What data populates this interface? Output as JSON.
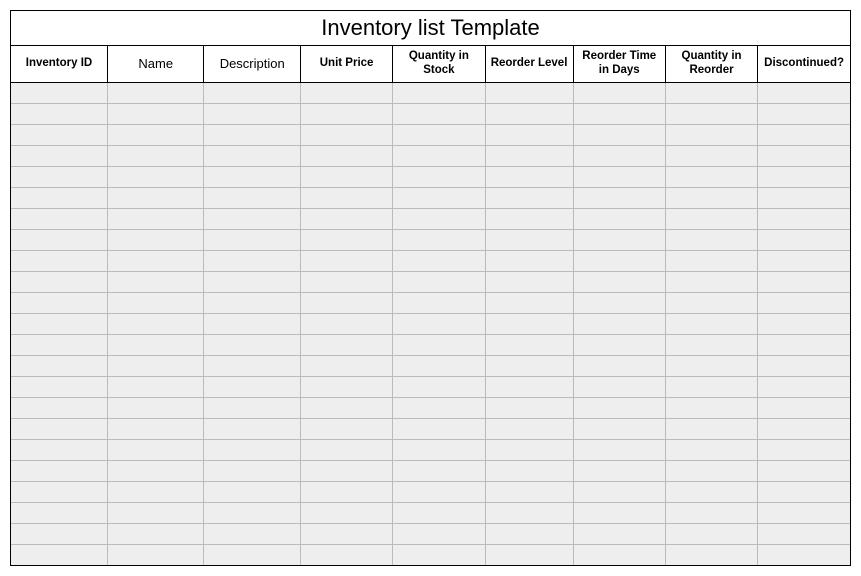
{
  "title": "Inventory list Template",
  "columns": [
    "Inventory ID",
    "Name",
    "Description",
    "Unit Price",
    "Quantity in Stock",
    "Reorder Level",
    "Reorder Time in Days",
    "Quantity in Reorder",
    "Discontinued?"
  ],
  "rows": [
    [
      "",
      "",
      "",
      "",
      "",
      "",
      "",
      "",
      ""
    ],
    [
      "",
      "",
      "",
      "",
      "",
      "",
      "",
      "",
      ""
    ],
    [
      "",
      "",
      "",
      "",
      "",
      "",
      "",
      "",
      ""
    ],
    [
      "",
      "",
      "",
      "",
      "",
      "",
      "",
      "",
      ""
    ],
    [
      "",
      "",
      "",
      "",
      "",
      "",
      "",
      "",
      ""
    ],
    [
      "",
      "",
      "",
      "",
      "",
      "",
      "",
      "",
      ""
    ],
    [
      "",
      "",
      "",
      "",
      "",
      "",
      "",
      "",
      ""
    ],
    [
      "",
      "",
      "",
      "",
      "",
      "",
      "",
      "",
      ""
    ],
    [
      "",
      "",
      "",
      "",
      "",
      "",
      "",
      "",
      ""
    ],
    [
      "",
      "",
      "",
      "",
      "",
      "",
      "",
      "",
      ""
    ],
    [
      "",
      "",
      "",
      "",
      "",
      "",
      "",
      "",
      ""
    ],
    [
      "",
      "",
      "",
      "",
      "",
      "",
      "",
      "",
      ""
    ],
    [
      "",
      "",
      "",
      "",
      "",
      "",
      "",
      "",
      ""
    ],
    [
      "",
      "",
      "",
      "",
      "",
      "",
      "",
      "",
      ""
    ],
    [
      "",
      "",
      "",
      "",
      "",
      "",
      "",
      "",
      ""
    ],
    [
      "",
      "",
      "",
      "",
      "",
      "",
      "",
      "",
      ""
    ],
    [
      "",
      "",
      "",
      "",
      "",
      "",
      "",
      "",
      ""
    ],
    [
      "",
      "",
      "",
      "",
      "",
      "",
      "",
      "",
      ""
    ],
    [
      "",
      "",
      "",
      "",
      "",
      "",
      "",
      "",
      ""
    ],
    [
      "",
      "",
      "",
      "",
      "",
      "",
      "",
      "",
      ""
    ],
    [
      "",
      "",
      "",
      "",
      "",
      "",
      "",
      "",
      ""
    ],
    [
      "",
      "",
      "",
      "",
      "",
      "",
      "",
      "",
      ""
    ],
    [
      "",
      "",
      "",
      "",
      "",
      "",
      "",
      "",
      ""
    ]
  ]
}
